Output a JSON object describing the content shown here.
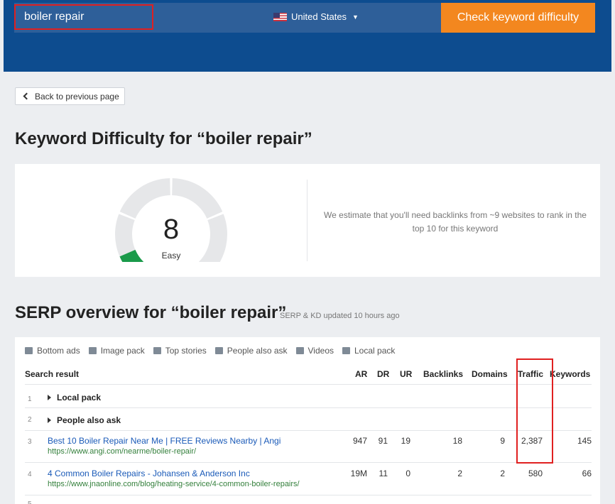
{
  "header": {
    "search_value": "boiler repair",
    "country": "United States",
    "check_button": "Check keyword difficulty"
  },
  "back_button": "Back to previous page",
  "kd": {
    "title": "Keyword Difficulty for “boiler repair”",
    "score": "8",
    "score_value": 8,
    "level": "Easy",
    "estimate": "We estimate that you'll need backlinks from ~9 websites to rank in the top 10 for this keyword",
    "colors": {
      "gauge_fill": "#1a9a4a",
      "gauge_track": "#e6e7e9"
    }
  },
  "serp": {
    "title": "SERP overview for “boiler repair”",
    "updated": "SERP & KD updated 10 hours ago",
    "features": [
      {
        "icon": "ads-icon",
        "label": "Bottom ads"
      },
      {
        "icon": "image-icon",
        "label": "Image pack"
      },
      {
        "icon": "news-icon",
        "label": "Top stories"
      },
      {
        "icon": "question-icon",
        "label": "People also ask"
      },
      {
        "icon": "video-icon",
        "label": "Videos"
      },
      {
        "icon": "pin-icon",
        "label": "Local pack"
      }
    ],
    "columns": {
      "result": "Search result",
      "ar": "AR",
      "dr": "DR",
      "ur": "UR",
      "backlinks": "Backlinks",
      "domains": "Domains",
      "traffic": "Traffic",
      "keywords": "Keywords"
    },
    "rows": [
      {
        "index": "1",
        "title": "Local pack"
      },
      {
        "index": "2",
        "title": "People also ask"
      },
      {
        "index": "3",
        "title": "Best 10 Boiler Repair Near Me | FREE Reviews Nearby | Angi",
        "url": "https://www.angi.com/nearme/boiler-repair/",
        "ar": "947",
        "dr": "91",
        "ur": "19",
        "backlinks": "18",
        "domains": "9",
        "traffic": "2,387",
        "keywords": "145"
      },
      {
        "index": "4",
        "title": "4 Common Boiler Repairs - Johansen & Anderson Inc",
        "url": "https://www.jnaonline.com/blog/heating-service/4-common-boiler-repairs/",
        "ar": "19M",
        "dr": "11",
        "ur": "0",
        "backlinks": "2",
        "domains": "2",
        "traffic": "580",
        "keywords": "66"
      },
      {
        "index": "5"
      }
    ]
  },
  "colors": {
    "header": "#0d4c8f",
    "accent_button": "#f3871f",
    "link": "#1a5ab8",
    "url": "#34803c",
    "highlight": "#e02020"
  }
}
